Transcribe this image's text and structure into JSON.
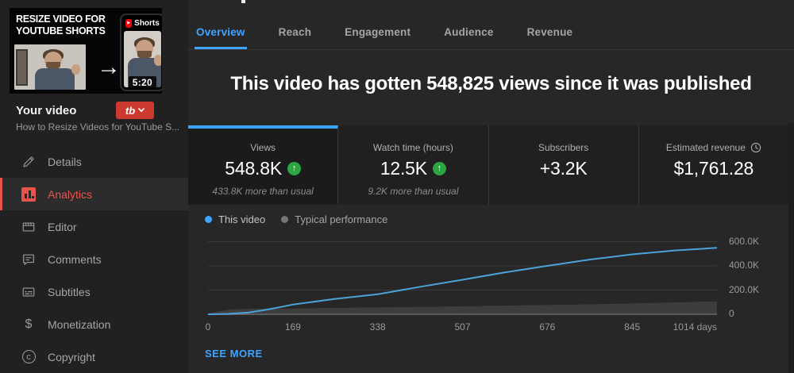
{
  "sidebar": {
    "section_label": "Your video",
    "video_title": "How to Resize Videos for YouTube S...",
    "extension_button_label": "tb",
    "thumbnail": {
      "headline_line1": "RESIZE VIDEO FOR",
      "headline_line2": "YOUTUBE SHORTS",
      "shorts_badge": "Shorts",
      "shorts_play_glyph": "▶",
      "arrow_glyph": "→",
      "duration": "5:20"
    },
    "menu": [
      {
        "label": "Details",
        "icon": "pencil-icon",
        "active": false
      },
      {
        "label": "Analytics",
        "icon": "bar-chart-icon",
        "active": true
      },
      {
        "label": "Editor",
        "icon": "clapperboard-icon",
        "active": false
      },
      {
        "label": "Comments",
        "icon": "comment-icon",
        "active": false
      },
      {
        "label": "Subtitles",
        "icon": "subtitles-icon",
        "active": false
      },
      {
        "label": "Monetization",
        "icon": "dollar-icon",
        "active": false,
        "glyph": "$"
      },
      {
        "label": "Copyright",
        "icon": "copyright-icon",
        "active": false,
        "glyph": "c"
      }
    ]
  },
  "tabs": [
    {
      "label": "Overview",
      "active": true
    },
    {
      "label": "Reach",
      "active": false
    },
    {
      "label": "Engagement",
      "active": false
    },
    {
      "label": "Audience",
      "active": false
    },
    {
      "label": "Revenue",
      "active": false
    }
  ],
  "headline": "This video has gotten 548,825 views since it was published",
  "cards": [
    {
      "label": "Views",
      "value": "548.8K",
      "badge": "up-arrow",
      "badge_glyph": "↑",
      "delta": "433.8K more than usual",
      "selected": true
    },
    {
      "label": "Watch time (hours)",
      "value": "12.5K",
      "badge": "up-arrow",
      "badge_glyph": "↑",
      "delta": "9.2K more than usual",
      "selected": false
    },
    {
      "label": "Subscribers",
      "value": "+3.2K",
      "selected": false
    },
    {
      "label": "Estimated revenue",
      "value": "$1,761.28",
      "label_icon": "clock-icon",
      "selected": false
    }
  ],
  "legend": [
    {
      "label": "This video",
      "color": "#3da5ff"
    },
    {
      "label": "Typical performance",
      "color": "#757575"
    }
  ],
  "chart_data": {
    "type": "line",
    "x_unit": "days",
    "x_max": 1014,
    "y_max": 600000,
    "grid": true,
    "legend_position": "top-left",
    "y_ticks": [
      {
        "v": 0,
        "label": "0"
      },
      {
        "v": 200000,
        "label": "200.0K"
      },
      {
        "v": 400000,
        "label": "400.0K"
      },
      {
        "v": 600000,
        "label": "600.0K"
      }
    ],
    "x_ticks": [
      {
        "d": 0,
        "label": "0"
      },
      {
        "d": 169,
        "label": "169"
      },
      {
        "d": 338,
        "label": "338"
      },
      {
        "d": 507,
        "label": "507"
      },
      {
        "d": 676,
        "label": "676"
      },
      {
        "d": 845,
        "label": "845"
      },
      {
        "d": 1014,
        "label": "1014 days",
        "align": "right"
      }
    ],
    "series": [
      {
        "name": "Typical performance",
        "style": "area",
        "color": "#3d3d3d",
        "points": [
          [
            0,
            0
          ],
          [
            20,
            25000
          ],
          [
            50,
            40000
          ],
          [
            100,
            46000
          ],
          [
            169,
            48000
          ],
          [
            300,
            55000
          ],
          [
            450,
            62000
          ],
          [
            600,
            72000
          ],
          [
            760,
            82000
          ],
          [
            845,
            90000
          ],
          [
            930,
            98000
          ],
          [
            1014,
            107000
          ]
        ]
      },
      {
        "name": "This video",
        "style": "line",
        "color": "#4ba3d9",
        "points": [
          [
            0,
            0
          ],
          [
            40,
            3000
          ],
          [
            80,
            14000
          ],
          [
            120,
            40000
          ],
          [
            169,
            80000
          ],
          [
            250,
            125000
          ],
          [
            338,
            165000
          ],
          [
            420,
            225000
          ],
          [
            507,
            285000
          ],
          [
            590,
            345000
          ],
          [
            676,
            400000
          ],
          [
            760,
            452000
          ],
          [
            845,
            495000
          ],
          [
            930,
            527000
          ],
          [
            1014,
            548800
          ]
        ]
      }
    ],
    "baseline_color": "#5c5c5c",
    "grid_color": "#3a3a3a"
  },
  "see_more_label": "SEE MORE",
  "colors": {
    "accent_blue": "#3da5ff",
    "active_red": "#e8544c",
    "positive_green": "#2ba640",
    "line_blue": "#4ba3d9",
    "band_gray": "#3d3d3d"
  }
}
